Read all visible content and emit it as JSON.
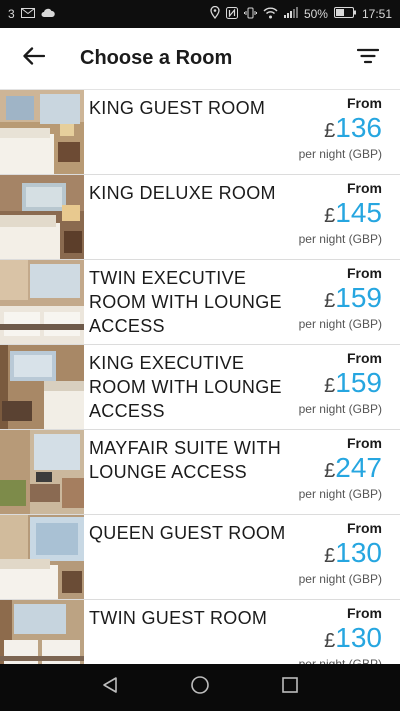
{
  "status_bar": {
    "notif_count": "3",
    "battery": "50%",
    "time": "17:51"
  },
  "app_bar": {
    "title": "Choose a Room"
  },
  "rooms": [
    {
      "name": "KING GUEST ROOM",
      "from": "From",
      "currency": "£",
      "price": "136",
      "note": "per night (GBP)"
    },
    {
      "name": "KING DELUXE ROOM",
      "from": "From",
      "currency": "£",
      "price": "145",
      "note": "per night (GBP)"
    },
    {
      "name": "TWIN EXECUTIVE ROOM WITH LOUNGE ACCESS",
      "from": "From",
      "currency": "£",
      "price": "159",
      "note": "per night (GBP)"
    },
    {
      "name": "KING EXECUTIVE ROOM WITH LOUNGE ACCESS",
      "from": "From",
      "currency": "£",
      "price": "159",
      "note": "per night (GBP)"
    },
    {
      "name": "MAYFAIR SUITE WITH LOUNGE ACCESS",
      "from": "From",
      "currency": "£",
      "price": "247",
      "note": "per night (GBP)"
    },
    {
      "name": "QUEEN GUEST ROOM",
      "from": "From",
      "currency": "£",
      "price": "130",
      "note": "per night (GBP)"
    },
    {
      "name": "TWIN GUEST ROOM",
      "from": "From",
      "currency": "£",
      "price": "130",
      "note": "per night (GBP)"
    }
  ],
  "colors": {
    "price_accent": "#26a6e0",
    "status_bg": "#0e0e0e",
    "nav_bg": "#0a0a0a"
  },
  "icons": {
    "back": "arrow-left-icon",
    "filter": "filter-icon",
    "nav_back": "triangle-back-icon",
    "nav_home": "circle-home-icon",
    "nav_recent": "square-recent-icon"
  }
}
